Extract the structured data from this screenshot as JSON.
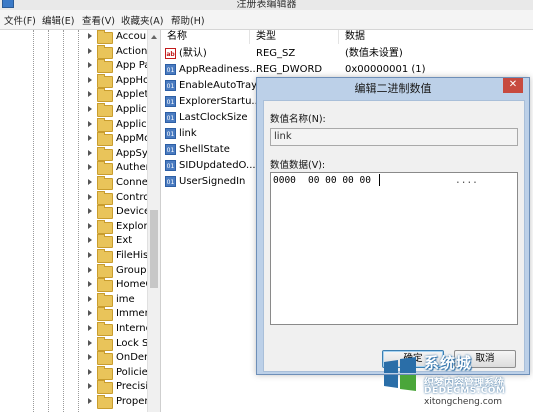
{
  "window": {
    "title": "注册表编辑器"
  },
  "menu": [
    "文件(F)",
    "编辑(E)",
    "查看(V)",
    "收藏夹(A)",
    "帮助(H)"
  ],
  "tree": {
    "items": [
      "Accoun",
      "Action",
      "App Pa",
      "AppHo",
      "Applet",
      "Applica",
      "Applica",
      "AppMo",
      "AppSy",
      "Auther",
      "Conne",
      "Contro",
      "Device",
      "Explor",
      "Ext",
      "FileHis",
      "Group",
      "HomeG",
      "ime",
      "Immer",
      "Interne",
      "Lock S",
      "OnDer",
      "Policie",
      "Precisi",
      "Proper"
    ]
  },
  "columns": {
    "name": "名称",
    "type": "类型",
    "data": "数据"
  },
  "values": [
    {
      "icon": "string-value-icon",
      "badge": "ab",
      "name": "(默认)",
      "type": "REG_SZ",
      "data": "(数值未设置)"
    },
    {
      "icon": "binary-value-icon",
      "badge": "01",
      "name": "AppReadiness...",
      "type": "REG_DWORD",
      "data": "0x00000001 (1)"
    },
    {
      "icon": "binary-value-icon",
      "badge": "01",
      "name": "EnableAutoTray",
      "type": "",
      "data": ""
    },
    {
      "icon": "binary-value-icon",
      "badge": "01",
      "name": "ExplorerStartu...",
      "type": "",
      "data": ""
    },
    {
      "icon": "binary-value-icon",
      "badge": "01",
      "name": "LastClockSize",
      "type": "",
      "data": ""
    },
    {
      "icon": "binary-value-icon",
      "badge": "01",
      "name": "link",
      "type": "",
      "data": ""
    },
    {
      "icon": "binary-value-icon",
      "badge": "01",
      "name": "ShellState",
      "type": "",
      "data": ""
    },
    {
      "icon": "binary-value-icon",
      "badge": "01",
      "name": "SIDUpdatedO...",
      "type": "",
      "data": ""
    },
    {
      "icon": "binary-value-icon",
      "badge": "01",
      "name": "UserSignedIn",
      "type": "",
      "data": ""
    }
  ],
  "dialog": {
    "title": "编辑二进制数值",
    "close": "✕",
    "name_label": "数值名称(N):",
    "name_value": "link",
    "data_label": "数值数据(V):",
    "offset": "0000",
    "bytes": "00 00 00 00",
    "ascii": "....",
    "ok": "确定",
    "cancel": "取消"
  },
  "watermark": {
    "title": "系统城",
    "line1": "织梦内容管理系统",
    "line2": "DEDECMS.COM",
    "line3": "xitongcheng.com",
    "colors": {
      "blue": "#2a6ea8",
      "green": "#4aa63a"
    }
  }
}
